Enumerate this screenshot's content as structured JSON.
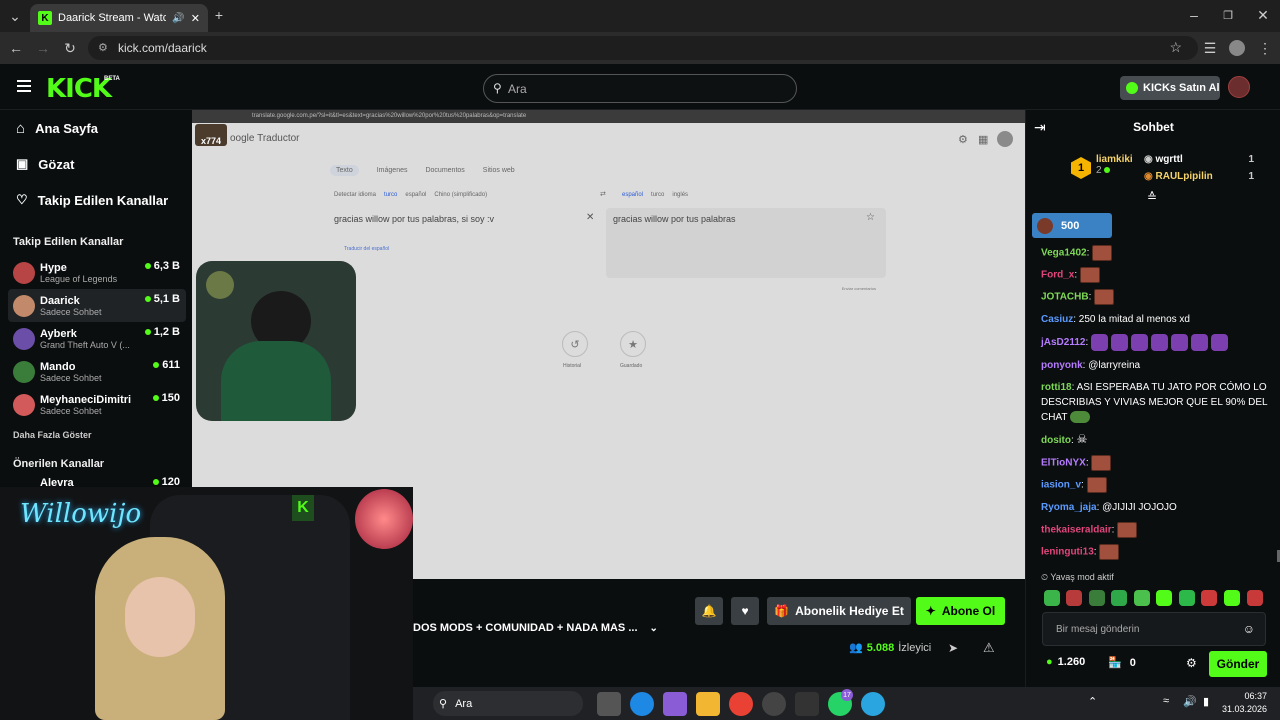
{
  "browser": {
    "tab_title": "Daarick Stream - Watch Liv",
    "url": "kick.com/daarick"
  },
  "header": {
    "logo": "KICK",
    "beta": "BETA",
    "search_placeholder": "Ara",
    "kicks_button": "KICKs Satın Al"
  },
  "sidebar": {
    "nav": [
      {
        "label": "Ana Sayfa",
        "icon": "home-icon"
      },
      {
        "label": "Gözat",
        "icon": "browse-icon"
      },
      {
        "label": "Takip Edilen Kanallar",
        "icon": "heart-icon"
      }
    ],
    "followed_title": "Takip Edilen Kanallar",
    "channels": [
      {
        "name": "Hype",
        "category": "League of Legends",
        "viewers": "6,3 B",
        "color": "#b84545"
      },
      {
        "name": "Daarick",
        "category": "Sadece Sohbet",
        "viewers": "5,1 B",
        "color": "#c28a6b"
      },
      {
        "name": "Ayberk",
        "category": "Grand Theft Auto V (...",
        "viewers": "1,2 B",
        "color": "#6b4ea8"
      },
      {
        "name": "Mando",
        "category": "Sadece Sohbet",
        "viewers": "611",
        "color": "#3a7d3a"
      },
      {
        "name": "MeyhaneciDimitri",
        "category": "Sadece Sohbet",
        "viewers": "150",
        "color": "#d25a5a"
      }
    ],
    "show_more": "Daha Fazla Göster",
    "recommended_title": "Önerilen Kanallar",
    "recommended_first": {
      "name": "Alevra",
      "viewers": "120"
    }
  },
  "video_content": {
    "inner_url": "translate.google.com.pe/?sl=it&tl=es&text=gracias%20willow%20por%20tus%20palabras&op=translate",
    "app_name": "Traductor",
    "badge": "x774",
    "modes": [
      "Texto",
      "Imágenes",
      "Documentos",
      "Sitios web"
    ],
    "src_langs": [
      "Detectar idioma",
      "turco",
      "español",
      "Chino (simplificado)"
    ],
    "tgt_langs": [
      "español",
      "turco",
      "inglés"
    ],
    "src_text": "gracias willow por tus palabras, si soy :v",
    "tgt_text": "gracias willow por tus palabras",
    "translate_from": "Traducir del español",
    "send_feedback": "Enviar comentarios",
    "history": "Historial",
    "saved": "Guardado"
  },
  "stream": {
    "title": "DOS MODS + COMUNIDAD + NADA MAS ...",
    "gift_button": "Abonelik Hediye Et",
    "subscribe_button": "Abone Ol",
    "viewers": "5.088",
    "viewers_label": "İzleyici",
    "webcam_sign": "Willowijo"
  },
  "chat": {
    "title": "Sohbet",
    "leaderboard": [
      {
        "rank": "1",
        "name": "liamkiki",
        "value": "2"
      },
      {
        "name": "wgrttl",
        "value": "1"
      },
      {
        "name": "RAULpipilin",
        "value": "1"
      }
    ],
    "goal_value": "500",
    "messages": [
      {
        "user": "Vega1402",
        "color": "#7ed957",
        "text": "",
        "emotes": 1
      },
      {
        "user": "Ford_x",
        "color": "#e0457b",
        "text": "",
        "emotes": 1
      },
      {
        "user": "JOTACHB",
        "color": "#7ed957",
        "text": "",
        "emotes": 1
      },
      {
        "user": "Casiuz",
        "color": "#5b9bff",
        "text": "250 la mitad al menos xd",
        "emotes": 0
      },
      {
        "user": "jAsD2112",
        "color": "#b57cff",
        "text": "",
        "emotes": 0,
        "purple": 7
      },
      {
        "user": "ponyonk",
        "color": "#b57cff",
        "text": "@larryreina",
        "emotes": 0
      },
      {
        "user": "rotti18",
        "color": "#7ed957",
        "text": "ASI ESPERABA TU JATO POR CÓMO LO DESCRIBIAS Y VIVIAS MEJOR QUE EL 90% DEL CHAT",
        "emotes": 0
      },
      {
        "user": "dosito",
        "color": "#7ed957",
        "text": "",
        "emotes": 0
      },
      {
        "user": "ElTioNYX",
        "color": "#b57cff",
        "text": "",
        "emotes": 1
      },
      {
        "user": "iasion_v",
        "color": "#5b9bff",
        "text": "",
        "emotes": 1
      },
      {
        "user": "Ryoma_jaja",
        "color": "#5b9bff",
        "text": "@JIJIJI JOJOJO",
        "emotes": 0
      },
      {
        "user": "thekaiseraldair",
        "color": "#e0457b",
        "text": "",
        "emotes": 1
      },
      {
        "user": "leninguti13",
        "color": "#e0457b",
        "text": "",
        "emotes": 1
      }
    ],
    "slow_mode": "Yavaş mod aktif",
    "input_placeholder": "Bir mesaj gönderin",
    "points": "1.260",
    "store_count": "0",
    "send_button": "Gönder"
  },
  "taskbar": {
    "search": "Ara",
    "time": "06:37",
    "date": "31.03.2026",
    "badge": "17"
  },
  "colors": {
    "kick_green": "#53fc18",
    "bg": "#0b0e0f"
  }
}
